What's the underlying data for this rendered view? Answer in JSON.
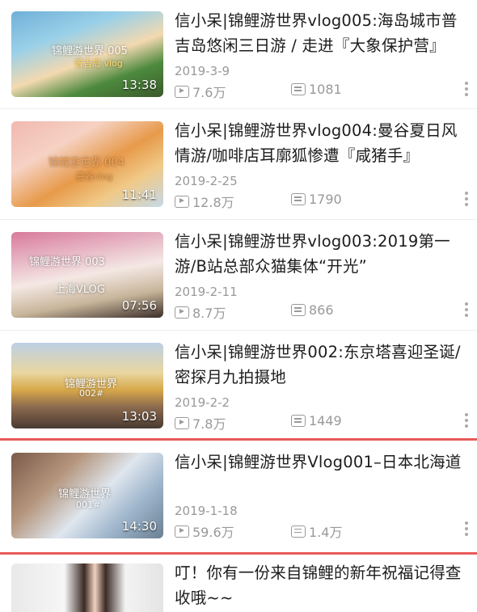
{
  "videos": [
    {
      "title": "信小呆|锦鲤游世界vlog005:海岛城市普吉岛悠闲三日游 / 走进『大象保护营』",
      "date": "2019-3-9",
      "views": "7.6万",
      "comments": "1081",
      "duration": "13:38",
      "watermark": "锦鲤游世界 005",
      "watermark2": "普吉岛 vlog"
    },
    {
      "title": "信小呆|锦鲤游世界vlog004:曼谷夏日风情游/咖啡店耳廓狐惨遭『咸猪手』",
      "date": "2019-2-25",
      "views": "12.8万",
      "comments": "1790",
      "duration": "11:41",
      "watermark": "锦鲤游世界 004",
      "watermark2": "曼谷vlog"
    },
    {
      "title": "信小呆|锦鲤游世界vlog003:2019第一游/B站总部众猫集体“开光”",
      "date": "2019-2-11",
      "views": "8.7万",
      "comments": "866",
      "duration": "07:56",
      "watermark": "锦鲤游世界 003",
      "watermark2": "上海VLOG"
    },
    {
      "title": "信小呆|锦鲤游世界002:东京塔喜迎圣诞/密探月九拍摄地",
      "date": "2019-2-2",
      "views": "7.8万",
      "comments": "1449",
      "duration": "13:03",
      "watermark": "锦鲤游世界",
      "watermark2": "002#"
    },
    {
      "title": "信小呆|锦鲤游世界Vlog001–日本北海道",
      "date": "2019-1-18",
      "views": "59.6万",
      "comments": "1.4万",
      "duration": "14:30",
      "watermark": "锦鲤游世界",
      "watermark2": "001#"
    },
    {
      "title": "叮！你有一份来自锦鲤的新年祝福记得查收哦~~",
      "date": "",
      "views": "",
      "comments": "",
      "duration": "",
      "watermark": "",
      "watermark2": ""
    }
  ],
  "colors": {
    "divider_highlight": "#e85a5a",
    "meta_text": "#999999"
  },
  "icons": {
    "views": "play-icon",
    "comments": "danmaku-icon",
    "more": "more-vertical-icon"
  }
}
